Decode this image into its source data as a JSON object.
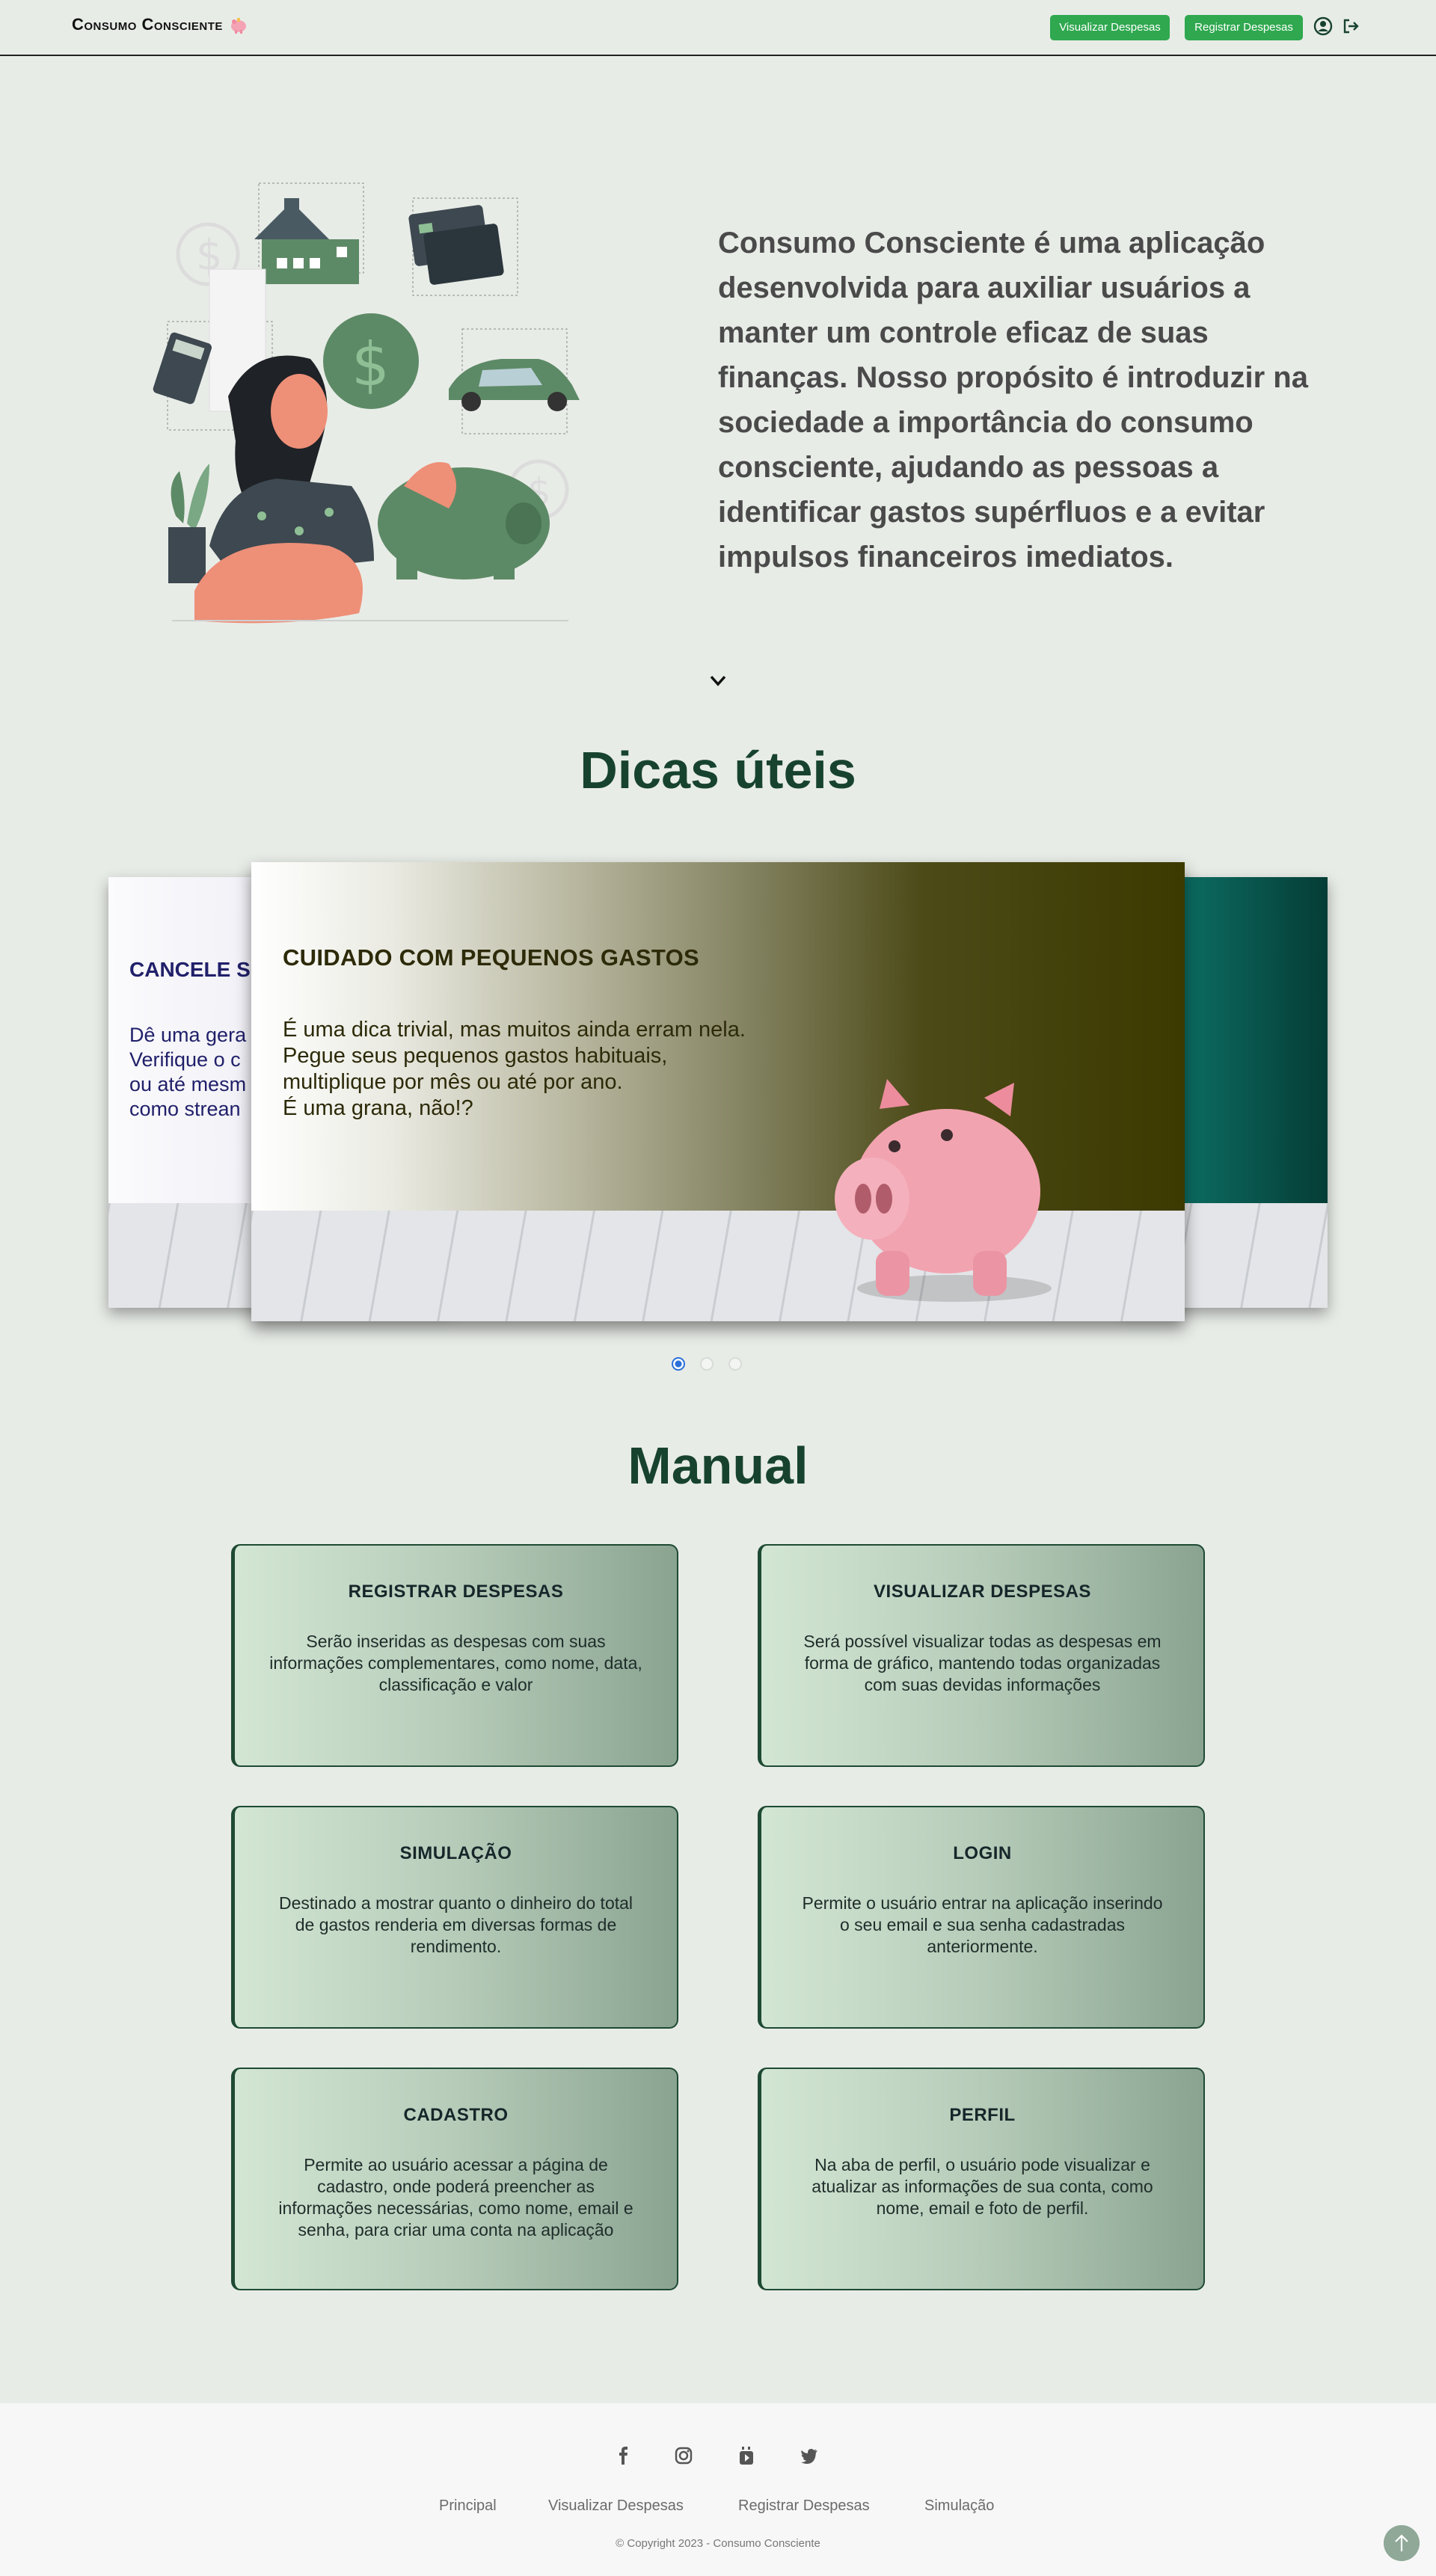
{
  "navbar": {
    "brand": "Consumo Consciente",
    "visualizar_label": "Visualizar Despesas",
    "registrar_label": "Registrar Despesas",
    "icons": [
      "user-circle-icon",
      "logout-icon"
    ],
    "button_color": "#2fa84f"
  },
  "hero": {
    "text": "Consumo Consciente é uma aplicação desenvolvida para auxiliar usuários a manter um controle eficaz de suas finanças. Nosso propósito é introduzir na sociedade a importância do consumo consciente, ajudando as pessoas a identificar gastos supérfluos e a evitar impulsos financeiros imediatos."
  },
  "dicas": {
    "title": "Dicas úteis",
    "slides": [
      {
        "title": "CUIDADO COM PEQUENOS GASTOS",
        "body": "É uma dica trivial, mas muitos ainda erram nela.\nPegue seus pequenos gastos habituais,\nmultiplique por mês ou até por ano.\nÉ uma grana, não!?"
      },
      {
        "title": "CANCELE S",
        "body": "Dê uma gera\nVerifique o c\nou até mesm\ncomo strean"
      }
    ],
    "active_index": 0,
    "slide_count": 3
  },
  "manual": {
    "title": "Manual",
    "cards": [
      {
        "title": "REGISTRAR DESPESAS",
        "body": "Serão inseridas as despesas com suas informações complementares, como nome, data, classificação e valor"
      },
      {
        "title": "VISUALIZAR DESPESAS",
        "body": "Será possível visualizar todas as despesas em forma de gráfico, mantendo todas organizadas com suas devidas informações"
      },
      {
        "title": "SIMULAÇÃO",
        "body": "Destinado a mostrar quanto o dinheiro do total de gastos renderia em diversas formas de rendimento."
      },
      {
        "title": "LOGIN",
        "body": "Permite o usuário entrar na aplicação inserindo o seu email e sua senha cadastradas anteriormente."
      },
      {
        "title": "CADASTRO",
        "body": "Permite ao usuário acessar a página de cadastro, onde poderá preencher as informações necessárias, como nome, email e senha, para criar uma conta na aplicação"
      },
      {
        "title": "PERFIL",
        "body": "Na aba de perfil, o usuário pode visualizar e atualizar as informações de sua conta, como nome, email e foto de perfil."
      }
    ]
  },
  "footer": {
    "social_icons": [
      "facebook-icon",
      "instagram-icon",
      "youtube-icon",
      "twitter-icon"
    ],
    "links": [
      "Principal",
      "Visualizar Despesas",
      "Registrar Despesas",
      "Simulação"
    ],
    "copyright": "© Copyright 2023 - Consumo Consciente"
  }
}
